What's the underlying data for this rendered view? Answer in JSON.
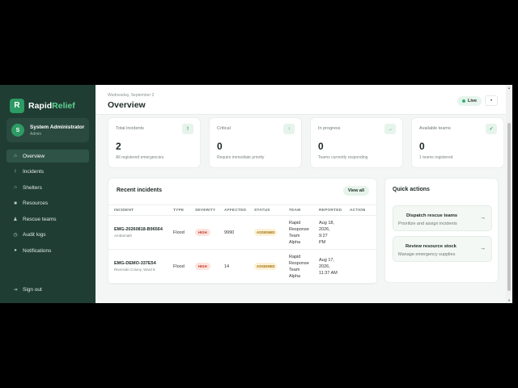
{
  "brand": {
    "logo_letter": "R",
    "name_part1": "Rapid",
    "name_part2": "Relief",
    "accent_color": "#5fd394"
  },
  "user": {
    "initial": "S",
    "name": "System Administrator",
    "role": "Admin"
  },
  "sidebar": {
    "items": [
      {
        "label": "Overview",
        "icon": "home-icon",
        "glyph": "⌂",
        "active": true
      },
      {
        "label": "Incidents",
        "icon": "alert-icon",
        "glyph": "!"
      },
      {
        "label": "Shelters",
        "icon": "shelter-icon",
        "glyph": "⌂"
      },
      {
        "label": "Resources",
        "icon": "box-icon",
        "glyph": "■"
      },
      {
        "label": "Rescue teams",
        "icon": "team-icon",
        "glyph": "♟"
      },
      {
        "label": "Audit logs",
        "icon": "clock-icon",
        "glyph": "◷"
      },
      {
        "label": "Notifications",
        "icon": "bell-icon",
        "glyph": "●"
      }
    ],
    "signout": {
      "label": "Sign out",
      "icon": "signout-icon",
      "glyph": "⇥"
    }
  },
  "header": {
    "date": "Wednesday, September 2",
    "title": "Overview",
    "live_label": "Live",
    "more_glyph": "•"
  },
  "stats": [
    {
      "label": "Total incidents",
      "value": "2",
      "sub": "All registered emergencies",
      "icon_glyph": "!"
    },
    {
      "label": "Critical",
      "value": "0",
      "sub": "Require immediate priority",
      "icon_glyph": "↑"
    },
    {
      "label": "In progress",
      "value": "0",
      "sub": "Teams currently responding",
      "icon_glyph": "→"
    },
    {
      "label": "Available teams",
      "value": "0",
      "sub": "1 teams registered",
      "icon_glyph": "✓"
    }
  ],
  "incidents": {
    "title": "Recent incidents",
    "view_all": "View all",
    "columns": [
      "INCIDENT",
      "TYPE",
      "SEVERITY",
      "AFFECTED",
      "STATUS",
      "TEAM",
      "REPORTED",
      "ACTION"
    ],
    "rows": [
      {
        "id": "EMG-20260818-B96564",
        "location": "Ambarnath",
        "type": "Flood",
        "severity": "HIGH",
        "affected": "9990",
        "status": "ASSIGNED",
        "team": [
          "Rapid",
          "Response",
          "Team",
          "Alpha"
        ],
        "reported": [
          "Aug 18,",
          "2026,",
          "9:27",
          "PM"
        ]
      },
      {
        "id": "EMG-DEMO-337E54",
        "location": "Riverside Colony, Ward 8",
        "type": "Flood",
        "severity": "HIGH",
        "affected": "14",
        "status": "ASSIGNED",
        "team": [
          "Rapid",
          "Response",
          "Team",
          "Alpha"
        ],
        "reported": [
          "Aug 17,",
          "2026,",
          "11:37 AM"
        ]
      }
    ]
  },
  "quick_actions": {
    "title": "Quick actions",
    "items": [
      {
        "name": "Dispatch rescue teams",
        "desc": "Prioritize and assign incidents",
        "arrow": "→"
      },
      {
        "name": "Review resource stock",
        "desc": "Manage emergency supplies",
        "arrow": "→"
      }
    ]
  }
}
